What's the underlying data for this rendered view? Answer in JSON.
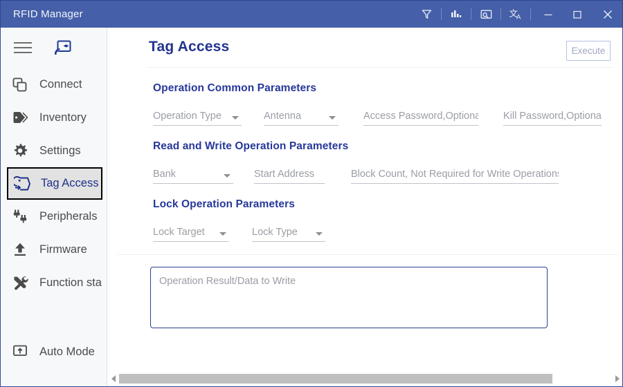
{
  "window": {
    "title": "RFID Manager",
    "titlebar_color": "#4560a8",
    "controls": {
      "filter_icon": "filter-icon",
      "chart_icon": "bar-chart-icon",
      "monitor_search_icon": "monitor-search-icon",
      "translate_icon": "translate-icon",
      "minimize_label": "─",
      "maximize_label": "□",
      "close_label": "✕"
    }
  },
  "sidebar": {
    "menu_icon": "hamburger-menu-icon",
    "cast_icon": "rfid-reader-icon",
    "items": [
      {
        "label": "Connect",
        "icon": "connect-icon",
        "selected": false
      },
      {
        "label": "Inventory",
        "icon": "tag-icon",
        "selected": false
      },
      {
        "label": "Settings",
        "icon": "gear-icon",
        "selected": false
      },
      {
        "label": "Tag Access",
        "icon": "tag-access-icon",
        "selected": true
      },
      {
        "label": "Peripherals",
        "icon": "plug-icon",
        "selected": false
      },
      {
        "label": "Firmware",
        "icon": "upload-icon",
        "selected": false
      },
      {
        "label": "Function sta",
        "icon": "tools-icon",
        "selected": false
      }
    ],
    "footer": {
      "label": "Auto Mode",
      "icon": "auto-mode-icon"
    }
  },
  "main": {
    "page_title": "Tag Access",
    "execute_label": "Execute",
    "sections": {
      "common": {
        "title": "Operation Common Parameters",
        "fields": [
          {
            "placeholder": "Operation Type",
            "type": "select"
          },
          {
            "placeholder": "Antenna",
            "type": "select"
          },
          {
            "placeholder": "Access Password,Optional",
            "type": "text"
          },
          {
            "placeholder": "Kill Password,Optional",
            "type": "text"
          }
        ]
      },
      "readwrite": {
        "title": "Read and Write Operation Parameters",
        "fields": [
          {
            "placeholder": "Bank",
            "type": "select"
          },
          {
            "placeholder": "Start Address",
            "type": "text"
          },
          {
            "placeholder": "Block Count, Not Required for Write Operations",
            "type": "text"
          }
        ]
      },
      "lock": {
        "title": "Lock Operation Parameters",
        "fields": [
          {
            "placeholder": "Lock Target",
            "type": "select"
          },
          {
            "placeholder": "Lock Type",
            "type": "select"
          }
        ]
      }
    },
    "result_placeholder": "Operation Result/Data to Write"
  },
  "colors": {
    "accent": "#4560a8",
    "heading": "#26389a",
    "selected_border": "#000000",
    "selected_bg": "#e2e2e2"
  }
}
